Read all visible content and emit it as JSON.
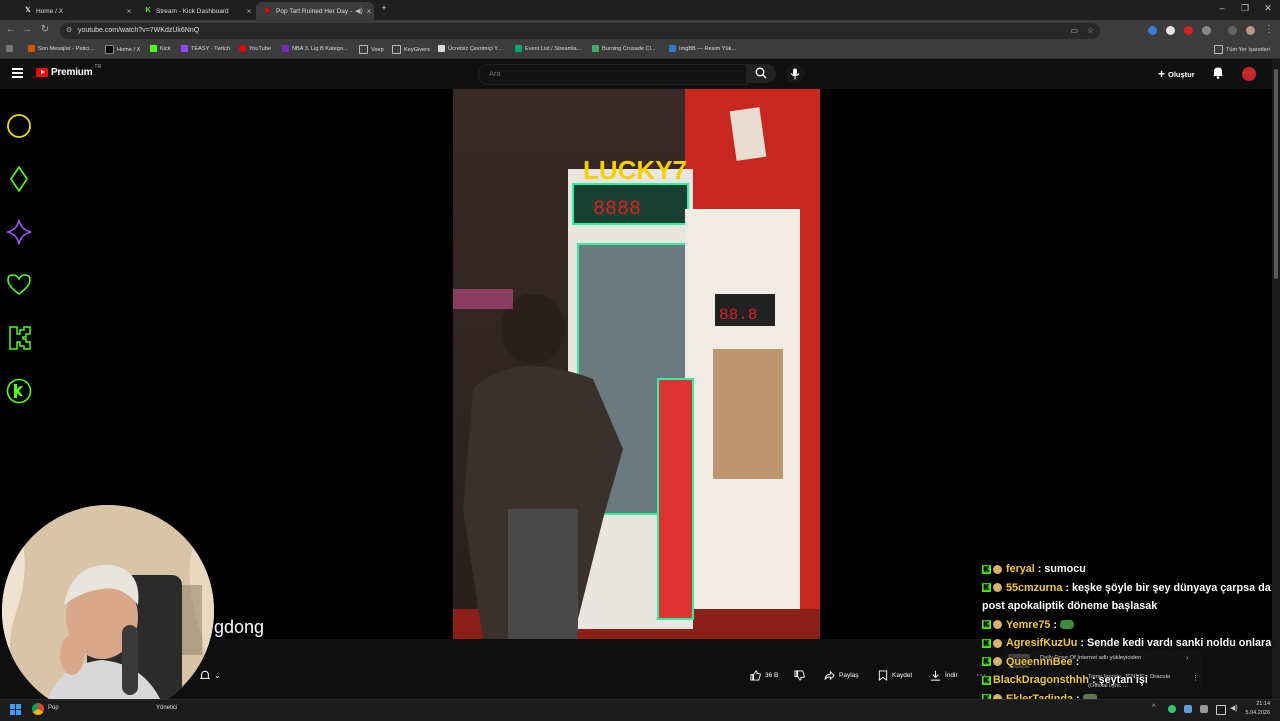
{
  "browser": {
    "tabs": [
      {
        "title": "Home / X",
        "icon": "x-logo-icon",
        "active": false
      },
      {
        "title": "Stream - Kick Dashboard",
        "icon": "kick-logo-icon",
        "active": false
      },
      {
        "title": "Pop Tart Ruined Her Day - Y",
        "icon": "youtube-logo-icon",
        "active": true
      }
    ],
    "new_tab": "+",
    "url": "youtube.com/watch?v=7WKdzUk6NnQ",
    "bookmarks": [
      "Son Mesajlar - Patici...",
      "Home / X",
      "Kick",
      "TEASY - Twitch",
      "YouTube",
      "NBA 3. Lig B Katego...",
      "Voep",
      "KeyGivers",
      "Ücretsiz Çevrimiçi Y...",
      "Event List / Streamla...",
      "Burning Crusade Cl...",
      "ImgBB — Resim Yük..."
    ],
    "all_bookmarks": "Tüm Yer İşaretleri"
  },
  "youtube": {
    "logo_text": "Premium",
    "logo_region": "TR",
    "search_placeholder": "Ara",
    "create_label": "Oluştur",
    "actions": {
      "like_count": "36 B",
      "share": "Paylaş",
      "save": "Kaydet",
      "download": "İndir"
    }
  },
  "overlay": {
    "caption": "gdong",
    "chat": [
      {
        "user": "feryal",
        "message": "sumocu"
      },
      {
        "user": "55cmzurna",
        "message": "keşke şöyle bir şey dünyaya çarpsa da post apokaliptik döneme başlasak"
      },
      {
        "user": "Yemre75",
        "message": ""
      },
      {
        "user": "AgresifKuzUu",
        "message": "Sende kedi vardı sanki noldu onlara"
      },
      {
        "user": "QueennnBee",
        "message": ""
      },
      {
        "user": "BlackDragonsthhh",
        "message": "şeytan işi"
      },
      {
        "user": "EklerTadinda",
        "message": ""
      }
    ],
    "notification": {
      "line1": "Daily Dose Of Internet adlı yükleyiciden",
      "line2": "Tame Impala, JENNIE - Dracula",
      "line3": "(Official Lyric ..."
    }
  },
  "taskbar": {
    "app_label": "Pop",
    "admin_label": "Yönetici",
    "time": "21:14",
    "date": "5.04.2026"
  },
  "colors": {
    "kick_green": "#53fc18",
    "youtube_red": "#ff0000",
    "chat_user": "#f3c933"
  }
}
